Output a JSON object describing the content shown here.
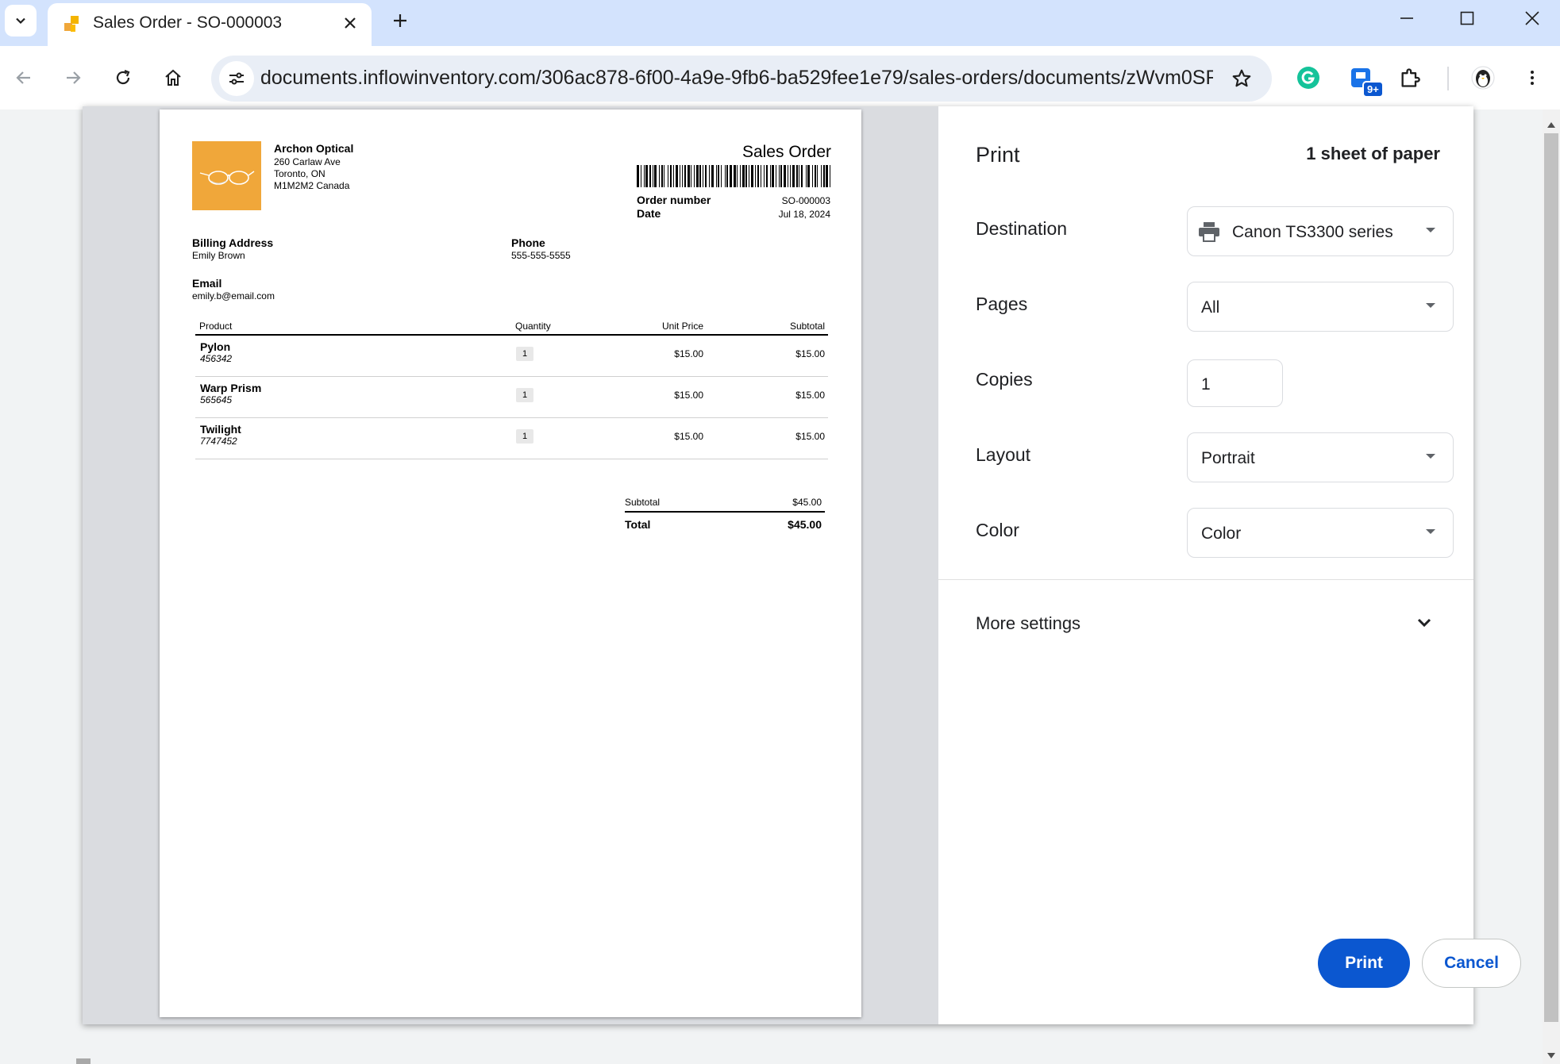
{
  "browser": {
    "tab_title": "Sales Order - SO-000003",
    "url": "documents.inflowinventory.com/306ac878-6f00-4a9e-9fb6-ba529fee1e79/sales-orders/documents/zWvm0SR...",
    "extension_badge": "9+",
    "icons": [
      "tab-search-icon",
      "inflow-favicon-icon",
      "close-icon",
      "plus-icon",
      "minimize-icon",
      "maximize-icon",
      "window-close-icon",
      "back-arrow-icon",
      "forward-arrow-icon",
      "reload-icon",
      "home-icon",
      "site-settings-icon",
      "star-icon",
      "grammarly-icon",
      "extension-badge-icon",
      "puzzle-icon",
      "profile-avatar-icon",
      "kebab-menu-icon"
    ]
  },
  "document": {
    "company": {
      "name": "Archon Optical",
      "address1": "260 Carlaw Ave",
      "address2": "Toronto, ON",
      "address3": "M1M2M2 Canada"
    },
    "title": "Sales Order",
    "order_number_label": "Order number",
    "order_number": "SO-000003",
    "date_label": "Date",
    "date": "Jul 18, 2024",
    "billing_label": "Billing Address",
    "billing_name": "Emily Brown",
    "phone_label": "Phone",
    "phone": "555-555-5555",
    "email_label": "Email",
    "email": "emily.b@email.com",
    "columns": [
      "Product",
      "Quantity",
      "Unit Price",
      "Subtotal"
    ],
    "items": [
      {
        "name": "Pylon",
        "sku": "456342",
        "qty": "1",
        "unit_price": "$15.00",
        "subtotal": "$15.00"
      },
      {
        "name": "Warp Prism",
        "sku": "565645",
        "qty": "1",
        "unit_price": "$15.00",
        "subtotal": "$15.00"
      },
      {
        "name": "Twilight",
        "sku": "7747452",
        "qty": "1",
        "unit_price": "$15.00",
        "subtotal": "$15.00"
      }
    ],
    "subtotal_label": "Subtotal",
    "subtotal": "$45.00",
    "total_label": "Total",
    "total": "$45.00",
    "colors": {
      "logo_bg": "#f0a73a"
    }
  },
  "print": {
    "title": "Print",
    "sheet_summary": "1 sheet of paper",
    "destination_label": "Destination",
    "destination_value": "Canon TS3300 series",
    "pages_label": "Pages",
    "pages_value": "All",
    "copies_label": "Copies",
    "copies_value": "1",
    "layout_label": "Layout",
    "layout_value": "Portrait",
    "color_label": "Color",
    "color_value": "Color",
    "more_settings_label": "More settings",
    "print_button": "Print",
    "cancel_button": "Cancel",
    "colors": {
      "accent": "#0b57d0"
    }
  }
}
